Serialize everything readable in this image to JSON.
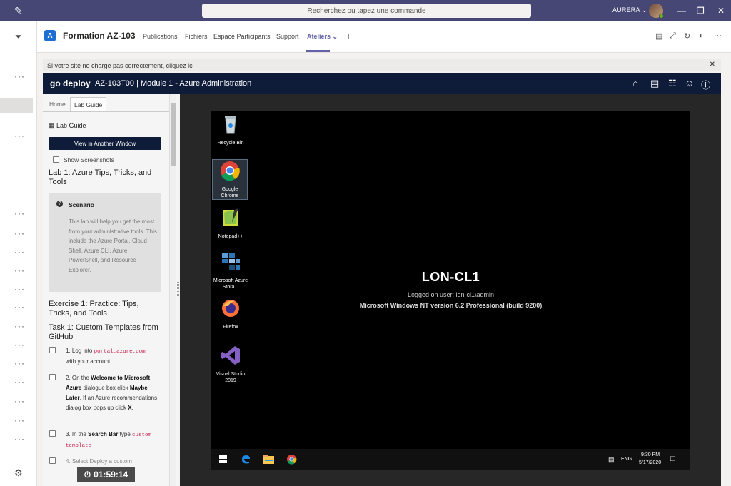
{
  "titlebar": {
    "search_placeholder": "Recherchez ou tapez une commande",
    "user": "AURERA",
    "colors": {
      "bar": "#464775"
    }
  },
  "app": {
    "title": "Formation AZ-103",
    "tabs": [
      "Publications",
      "Fichiers",
      "Espace Participants",
      "Support",
      "Ateliers"
    ],
    "active_tab": "Ateliers"
  },
  "notice": {
    "text": "Si votre site ne charge pas correctement, cliquez ici"
  },
  "godeploy": {
    "logo": "go deploy",
    "title": "AZ-103T00 | Module 1 - Azure Administration"
  },
  "guide": {
    "tabs": [
      "Home",
      "Lab Guide"
    ],
    "section_label": "Lab Guide",
    "open_button": "View in Another Window",
    "show_screenshots": "Show Screenshots",
    "lab_title": "Lab 1: Azure Tips, Tricks, and Tools",
    "scenario_title": "Scenario",
    "scenario_text": "This lab will help you get the most from your administrative tools. This include the Azure Portal, Cloud Shell, Azure CLI, Azure PowerShell, and Resource Explorer.",
    "exercise_title": "Exercise 1: Practice: Tips, Tricks, and Tools",
    "task_title": "Task 1: Custom Templates from GitHub",
    "steps": {
      "s1_pre": "1. Log into",
      "s1_code": "portal.azure.com",
      "s1_post": "with your account",
      "s2_pre": "2. On the",
      "s2_b1": "Welcome to Microsoft Azure",
      "s2_mid": "dialogue box click",
      "s2_b2": "Maybe Later",
      "s2_mid2": ". If an Azure recommendations dialog box pops up click",
      "s2_b3": "X",
      "s3_pre": "3. In the",
      "s3_b": "Search Bar",
      "s3_mid": "type",
      "s3_code": "custom template",
      "s4": "4. Select Deploy a custom"
    },
    "timer": "01:59:14"
  },
  "desktop": {
    "icons": [
      "Recycle Bin",
      "Google Chrome",
      "Notepad++",
      "Microsoft Azure Stora...",
      "Firefox",
      "Visual Studio 2019"
    ],
    "hostname": "LON-CL1",
    "logged_on": "Logged on user: lon-cl1\\admin",
    "os_info": "Microsoft Windows NT version 6.2 Professional  (build 9200)",
    "tray_lang": "ENG",
    "tray_time": "9:30 PM",
    "tray_date": "5/17/2020"
  }
}
